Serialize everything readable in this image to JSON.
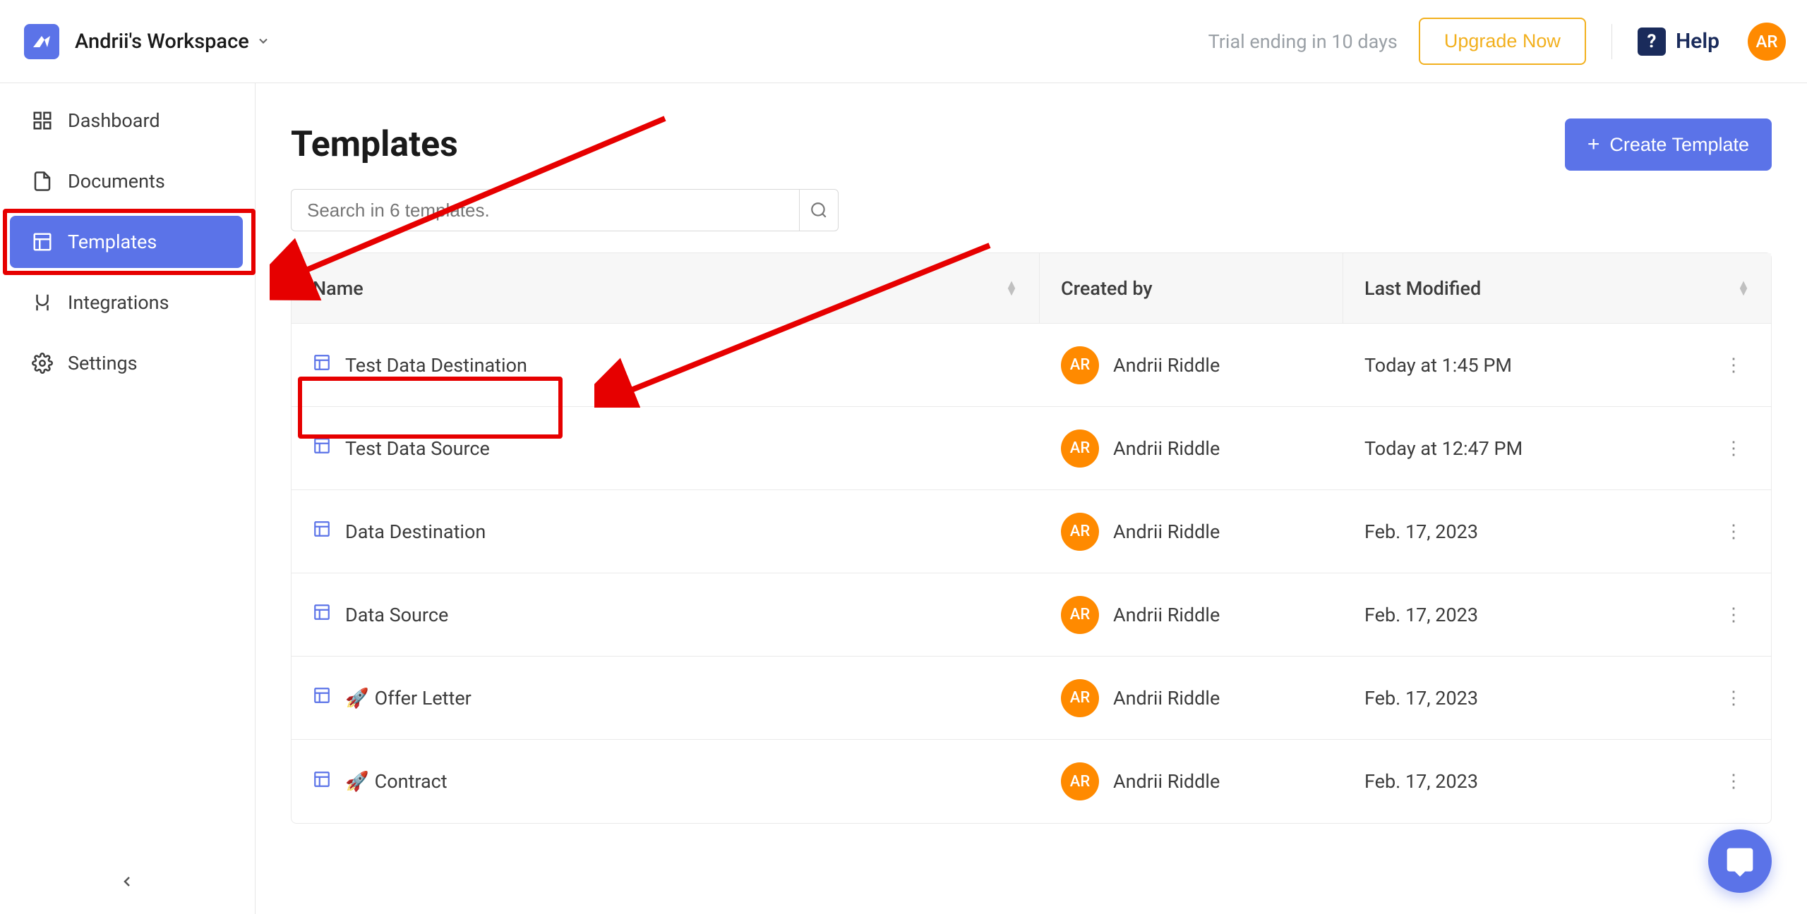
{
  "header": {
    "workspace_name": "Andrii's Workspace",
    "trial_text": "Trial ending in 10 days",
    "upgrade_label": "Upgrade Now",
    "help_label": "Help",
    "avatar_initials": "AR"
  },
  "sidebar": {
    "items": [
      {
        "label": "Dashboard"
      },
      {
        "label": "Documents"
      },
      {
        "label": "Templates"
      },
      {
        "label": "Integrations"
      },
      {
        "label": "Settings"
      }
    ]
  },
  "page": {
    "title": "Templates",
    "create_label": "Create Template",
    "search_placeholder": "Search in 6 templates."
  },
  "table": {
    "columns": {
      "name": "Name",
      "created_by": "Created by",
      "last_modified": "Last Modified"
    },
    "rows": [
      {
        "name": "Test Data Destination",
        "creator_initials": "AR",
        "creator_name": "Andrii Riddle",
        "modified": "Today at 1:45 PM",
        "emoji": ""
      },
      {
        "name": "Test Data Source",
        "creator_initials": "AR",
        "creator_name": "Andrii Riddle",
        "modified": "Today at 12:47 PM",
        "emoji": ""
      },
      {
        "name": "Data Destination",
        "creator_initials": "AR",
        "creator_name": "Andrii Riddle",
        "modified": "Feb. 17, 2023",
        "emoji": ""
      },
      {
        "name": "Data Source",
        "creator_initials": "AR",
        "creator_name": "Andrii Riddle",
        "modified": "Feb. 17, 2023",
        "emoji": ""
      },
      {
        "name": "Offer Letter",
        "creator_initials": "AR",
        "creator_name": "Andrii Riddle",
        "modified": "Feb. 17, 2023",
        "emoji": "🚀"
      },
      {
        "name": "Contract",
        "creator_initials": "AR",
        "creator_name": "Andrii Riddle",
        "modified": "Feb. 17, 2023",
        "emoji": "🚀"
      }
    ]
  }
}
